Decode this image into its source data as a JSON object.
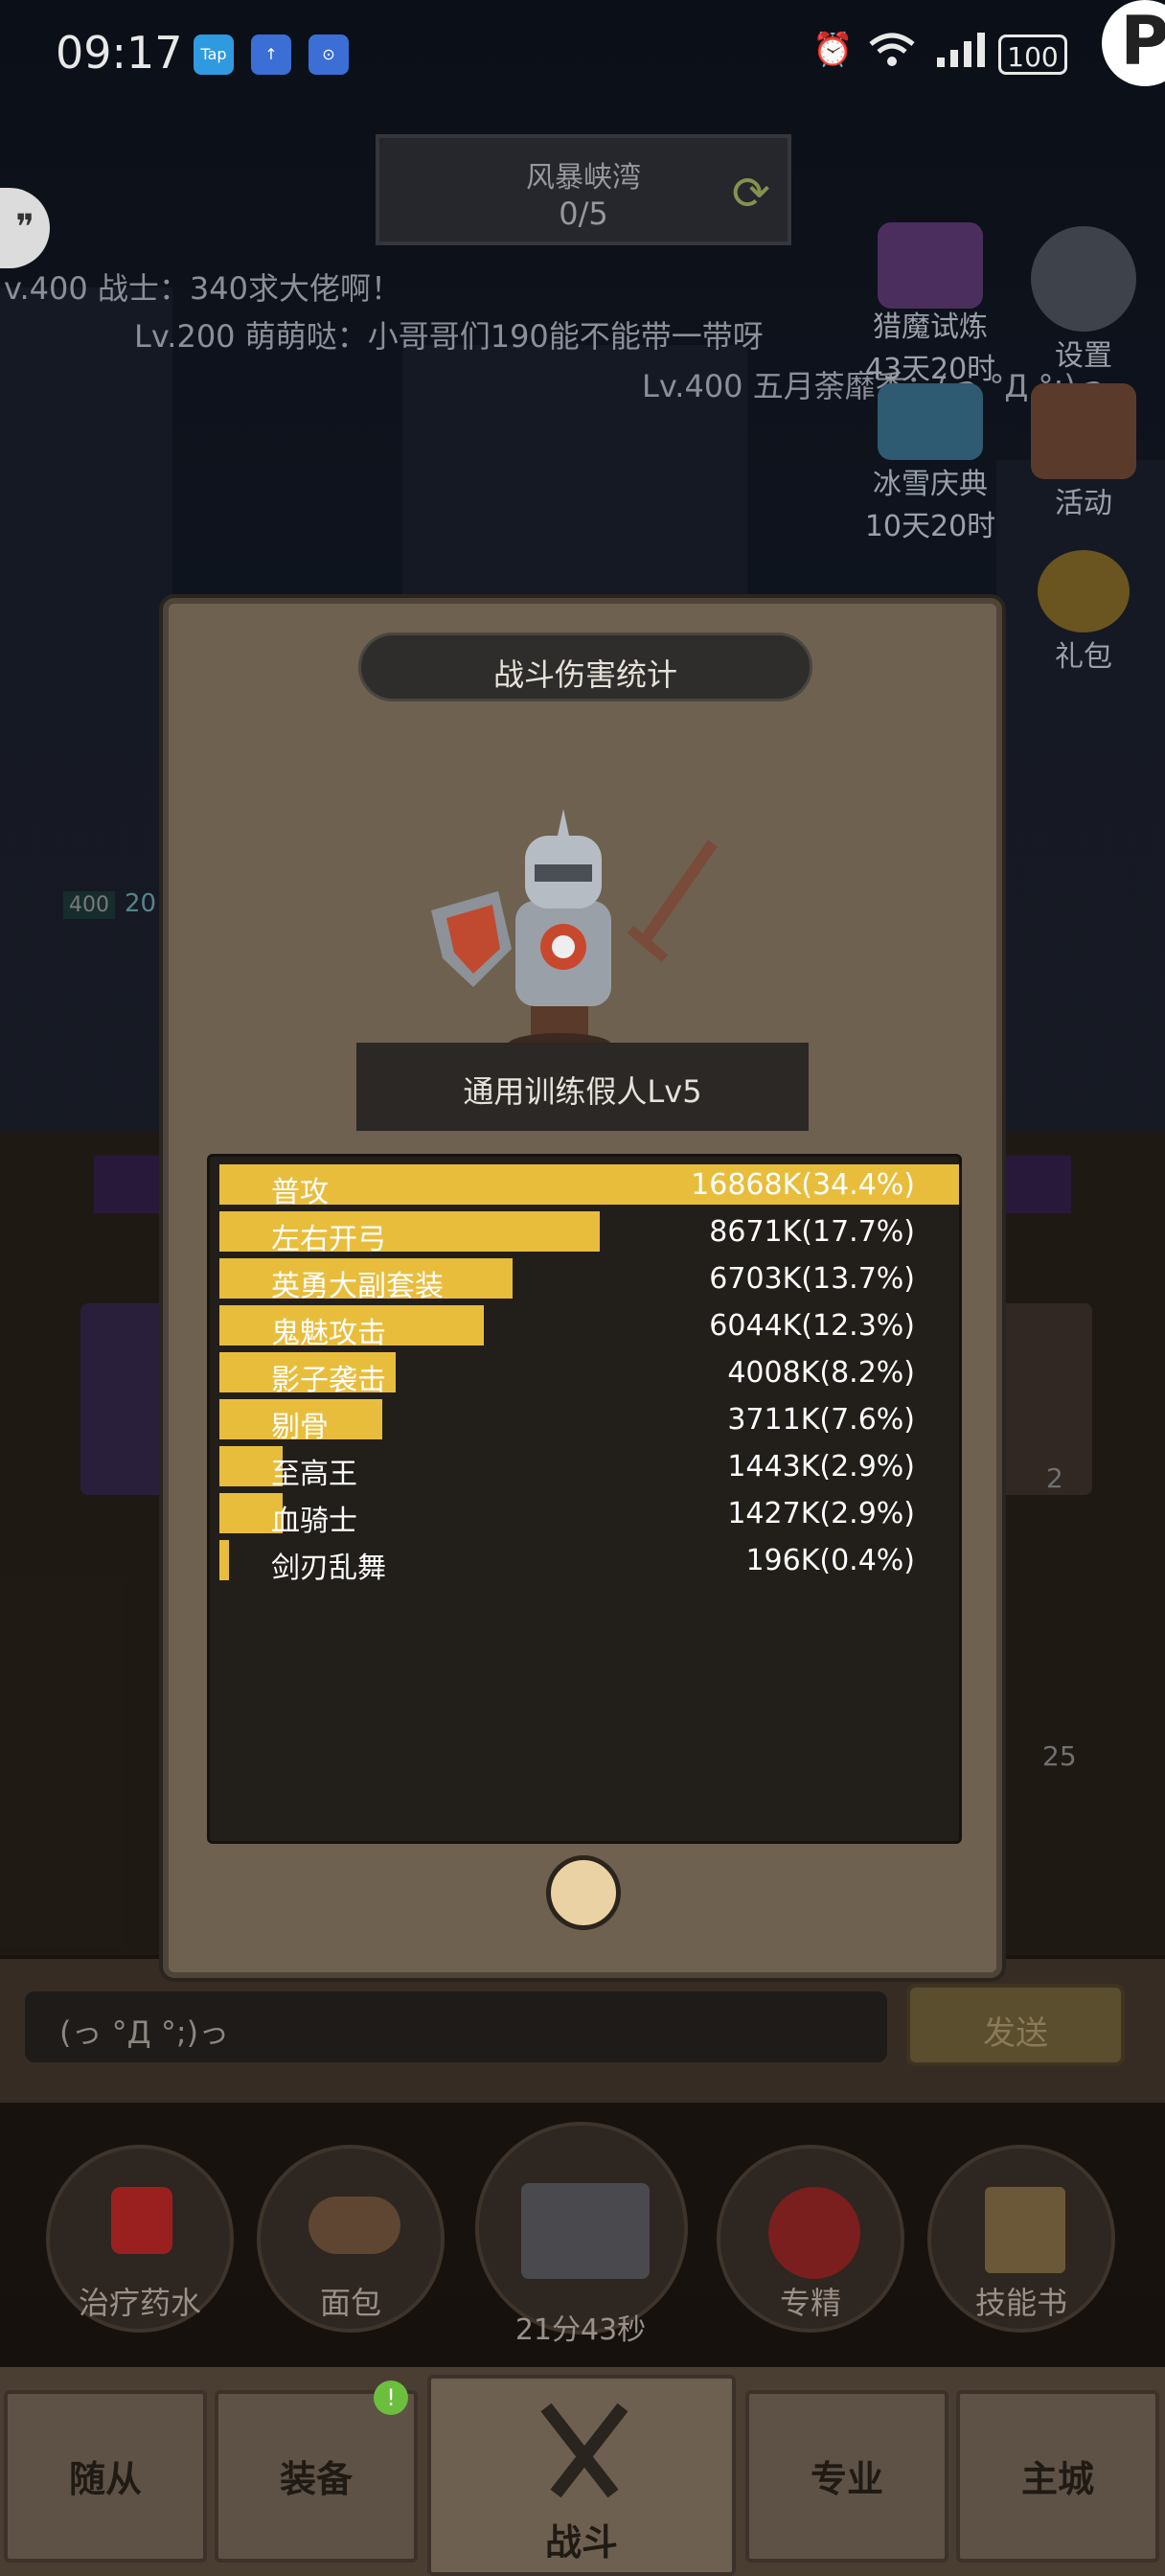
{
  "status_bar": {
    "time": "09:17",
    "apps": [
      "Tap",
      "↑",
      "⊙"
    ],
    "battery": "100"
  },
  "zone": {
    "name": "风暴峡湾",
    "progress": "0/5"
  },
  "chat_feed": [
    "v.400 战士：340求大佬啊！",
    "Lv.200 萌萌哒：小哥哥们190能不能带一带呀",
    "Lv.400 五月荼靡香：(っ °Д °;)っ"
  ],
  "side_menu": {
    "hunt": {
      "label": "猎魔试炼",
      "timer": "43天20时"
    },
    "ice": {
      "label": "冰雪庆典",
      "timer": "10天20时"
    },
    "settings": "设置",
    "events": "活动",
    "gift": "礼包"
  },
  "modal": {
    "title": "战斗伤害统计",
    "enemy": "通用训练假人Lv5",
    "bar_color": "#e9bd3c",
    "rows": [
      {
        "name": "普攻",
        "value": "16868K(34.4%)",
        "share": 1.0
      },
      {
        "name": "左右开弓",
        "value": "8671K(17.7%)",
        "share": 0.514
      },
      {
        "name": "英勇大副套装",
        "value": "6703K(13.7%)",
        "share": 0.397
      },
      {
        "name": "鬼魅攻击",
        "value": "6044K(12.3%)",
        "share": 0.358
      },
      {
        "name": "影子袭击",
        "value": "4008K(8.2%)",
        "share": 0.238
      },
      {
        "name": "剔骨",
        "value": "3711K(7.6%)",
        "share": 0.22
      },
      {
        "name": "至高王",
        "value": "1443K(2.9%)",
        "share": 0.086
      },
      {
        "name": "血骑士",
        "value": "1427K(2.9%)",
        "share": 0.085
      },
      {
        "name": "剑刃乱舞",
        "value": "196K(0.4%)",
        "share": 0.012
      }
    ]
  },
  "chat_input": {
    "text": "(っ °Д °;)っ",
    "send": "发送"
  },
  "consumables": [
    "治疗药水",
    "面包",
    "专精",
    "技能书"
  ],
  "chest_timer": "21分43秒",
  "nav": {
    "tabs": [
      "随从",
      "装备",
      "战斗",
      "专业",
      "主城"
    ],
    "badge": "!"
  },
  "levels": {
    "left_level": "400",
    "left_hp": "20"
  },
  "side_counts": [
    "2",
    "25"
  ]
}
